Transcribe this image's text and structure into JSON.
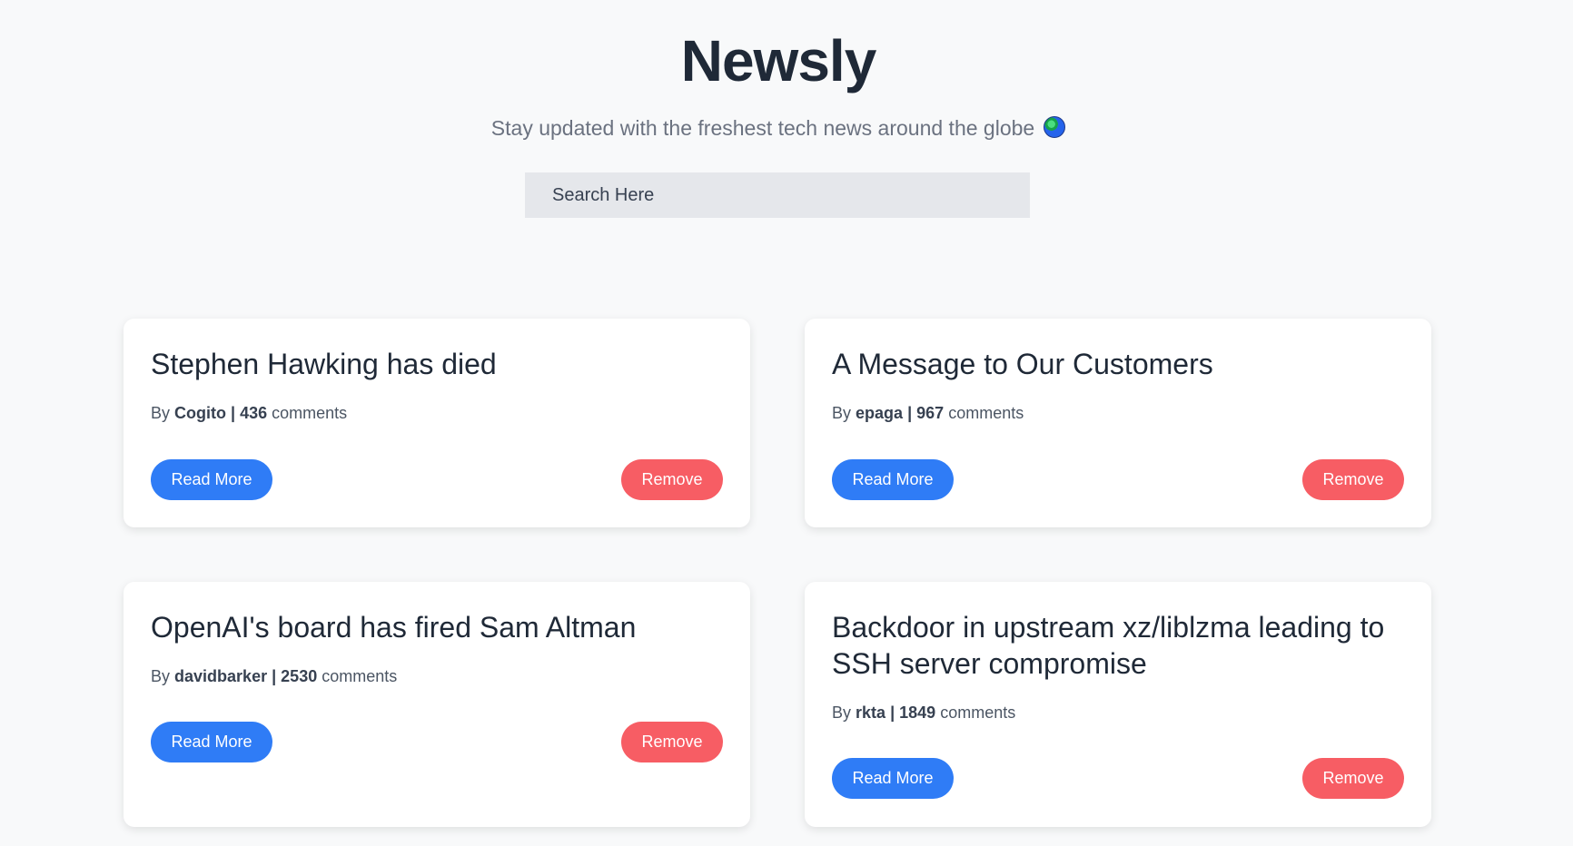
{
  "header": {
    "title": "Newsly",
    "subtitle": "Stay updated with the freshest tech news around the globe",
    "subtitle_icon": "globe-icon"
  },
  "search": {
    "placeholder": "Search Here",
    "value": ""
  },
  "colors": {
    "read_more": "#2f7cf6",
    "remove": "#f75d64",
    "background": "#f8f9fa",
    "search_bg": "#e5e7eb"
  },
  "labels": {
    "by": "By",
    "comments": "comments",
    "separator": "|",
    "read_more": "Read More",
    "remove": "Remove"
  },
  "articles": [
    {
      "title": "Stephen Hawking has died",
      "author": "Cogito",
      "comments": "436"
    },
    {
      "title": "A Message to Our Customers",
      "author": "epaga",
      "comments": "967"
    },
    {
      "title": "OpenAI's board has fired Sam Altman",
      "author": "davidbarker",
      "comments": "2530"
    },
    {
      "title": "Backdoor in upstream xz/liblzma leading to SSH server compromise",
      "author": "rkta",
      "comments": "1849"
    }
  ]
}
